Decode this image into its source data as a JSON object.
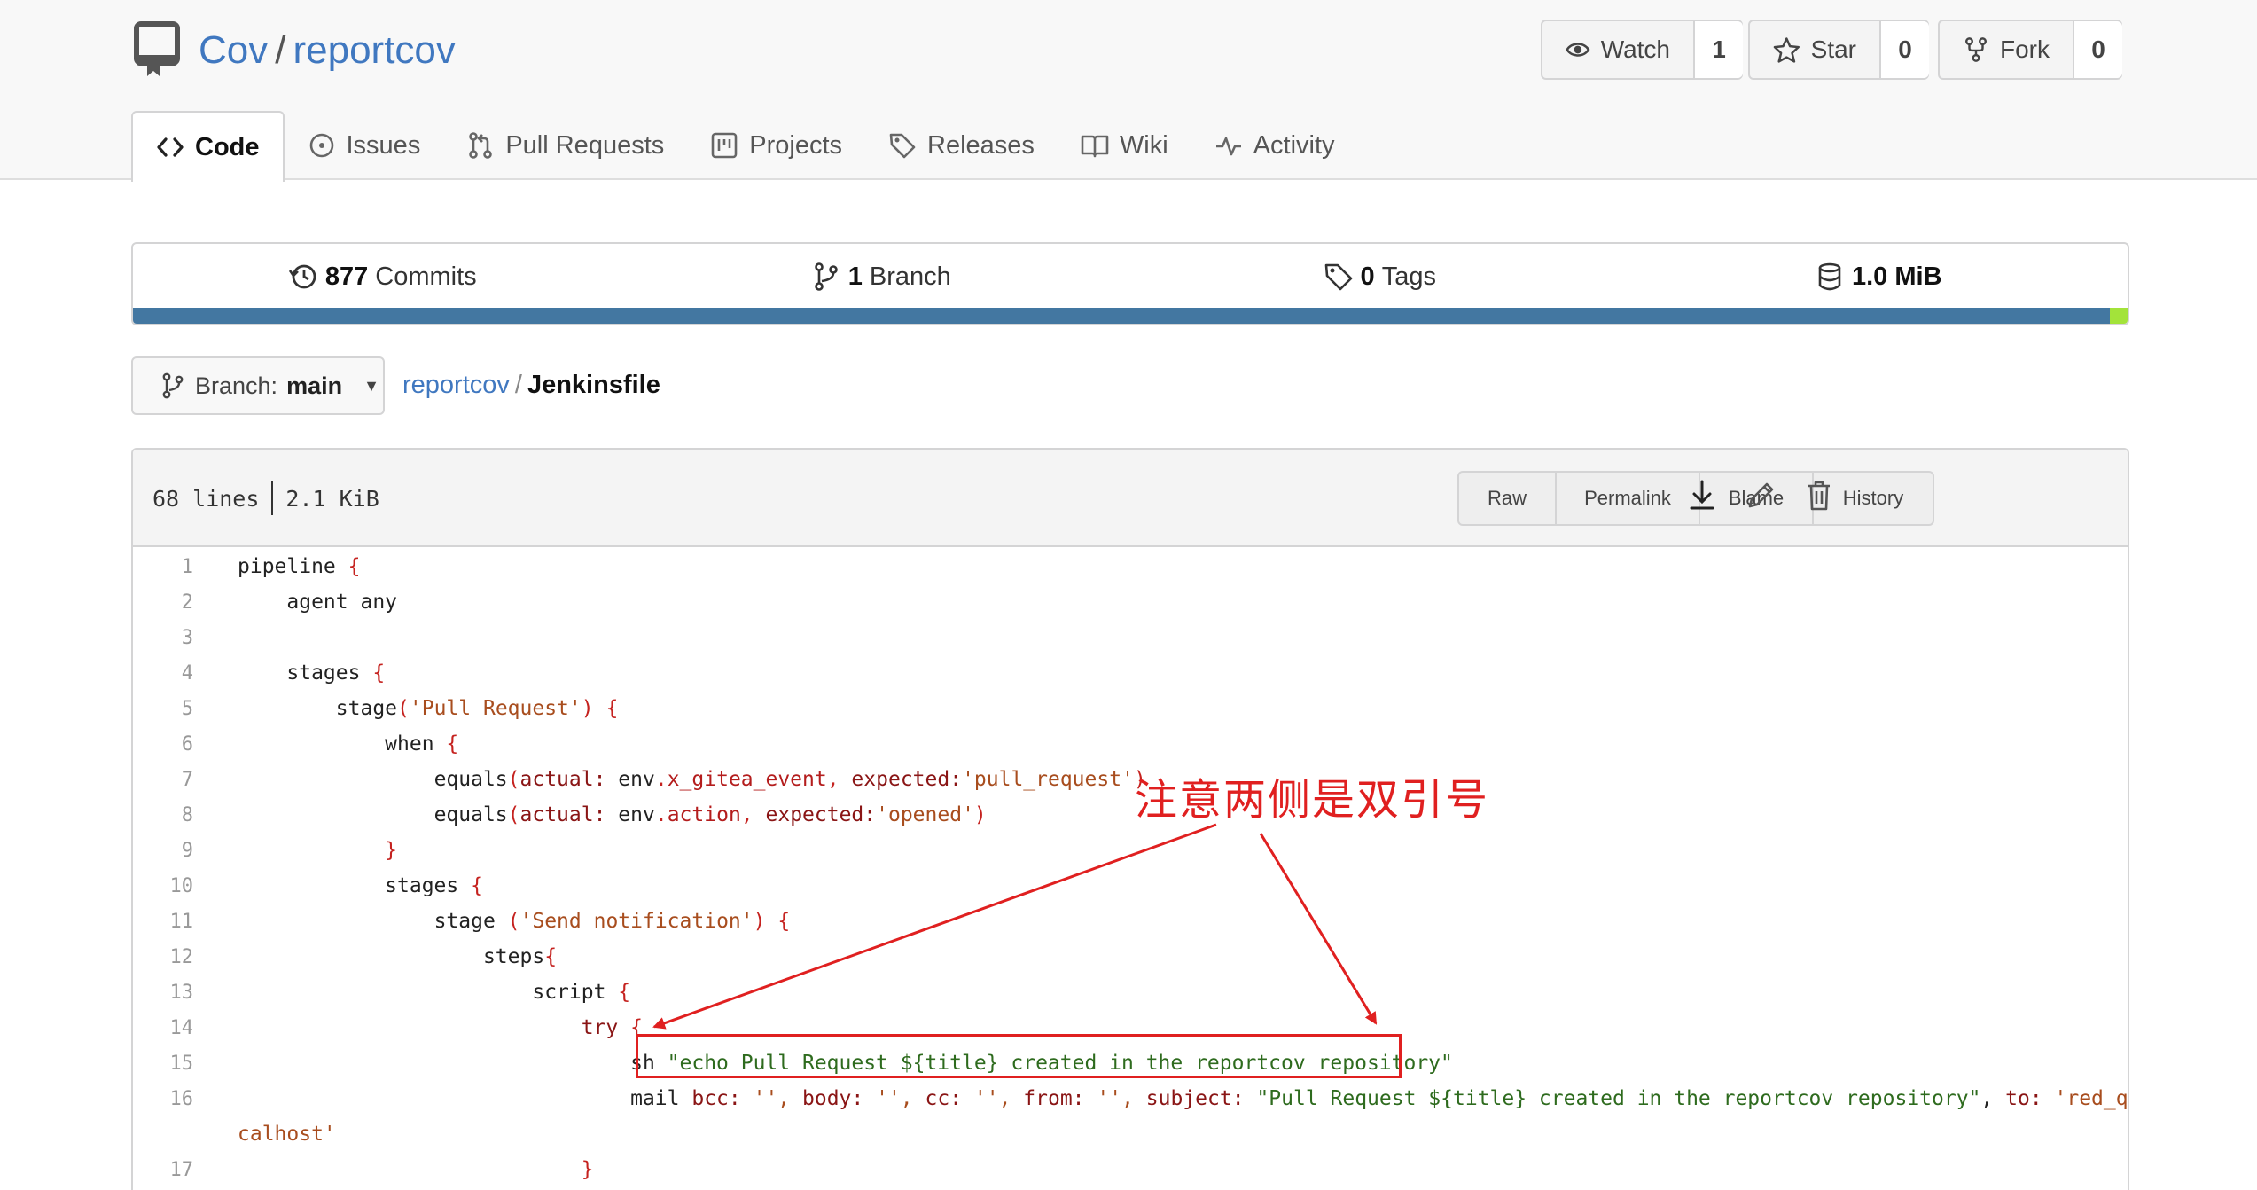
{
  "repo": {
    "owner": "Cov",
    "separator": "/",
    "name": "reportcov"
  },
  "actions": [
    {
      "label": "Watch",
      "icon": "eye-icon",
      "count": "1"
    },
    {
      "label": "Star",
      "icon": "star-icon",
      "count": "0"
    },
    {
      "label": "Fork",
      "icon": "fork-icon",
      "count": "0"
    }
  ],
  "tabs": [
    {
      "label": "Code",
      "icon": "code-icon",
      "active": true
    },
    {
      "label": "Issues",
      "icon": "issue-icon"
    },
    {
      "label": "Pull Requests",
      "icon": "pull-request-icon"
    },
    {
      "label": "Projects",
      "icon": "project-icon"
    },
    {
      "label": "Releases",
      "icon": "tag-icon"
    },
    {
      "label": "Wiki",
      "icon": "book-icon"
    },
    {
      "label": "Activity",
      "icon": "pulse-icon"
    }
  ],
  "stats": {
    "commits": {
      "value": "877",
      "label": "Commits"
    },
    "branches": {
      "value": "1",
      "label": "Branch"
    },
    "tags": {
      "value": "0",
      "label": "Tags"
    },
    "size": {
      "value": "1.0 MiB"
    }
  },
  "language_colors": {
    "primary": "#4377a1",
    "secondary": "#a3e33a"
  },
  "branch": {
    "prefix": "Branch:",
    "name": "main"
  },
  "breadcrumb": {
    "repo": "reportcov",
    "sep": "/",
    "file": "Jenkinsfile"
  },
  "file": {
    "lines": "68 lines",
    "size": "2.1 KiB",
    "buttons": [
      "Raw",
      "Permalink",
      "Blame",
      "History"
    ]
  },
  "code": [
    {
      "n": "1"
    },
    {
      "n": "2"
    },
    {
      "n": "3"
    },
    {
      "n": "4"
    },
    {
      "n": "5"
    },
    {
      "n": "6"
    },
    {
      "n": "7"
    },
    {
      "n": "8"
    },
    {
      "n": "9"
    },
    {
      "n": "10"
    },
    {
      "n": "11"
    },
    {
      "n": "12"
    },
    {
      "n": "13"
    },
    {
      "n": "14"
    },
    {
      "n": "15"
    },
    {
      "n": "16"
    },
    {
      "n": "17"
    }
  ],
  "code_text": {
    "l1": "pipeline",
    "l2": "agent any",
    "l4": "stages",
    "l5a": "stage",
    "l5b": "'Pull Request'",
    "l6": "when",
    "l7a": "equals",
    "l7b": "actual:",
    "l7c": " env",
    "l7d": "x_gitea_event",
    "l7e": " expected:",
    "l7f": "'pull_request'",
    "l8a": "equals",
    "l8b": "actual:",
    "l8c": " env",
    "l8d": "action",
    "l8e": " expected:",
    "l8f": "'opened'",
    "l10": "stages",
    "l11a": "stage ",
    "l11b": "'Send notification'",
    "l12": "steps",
    "l13": "script",
    "l14": "try",
    "l15a": "sh ",
    "l15b": "\"echo Pull Request ${title} created in the reportcov repository\"",
    "l16a": "mail ",
    "l16b": "bcc:",
    "l16c": " '', ",
    "l16d": "body:",
    "l16e": " '', ",
    "l16f": "cc:",
    "l16g": " '', ",
    "l16h": "from:",
    "l16i": " '', ",
    "l16j": "subject:",
    "l16k": " \"Pull Request ${title} created in the reportcov repository\"",
    "l16l": ", ",
    "l16m": "to:",
    "l16n": " 'red_queen@lo",
    "l16cont": "calhost'"
  },
  "annotation": {
    "text": "注意两侧是双引号",
    "color": "#e02020"
  }
}
